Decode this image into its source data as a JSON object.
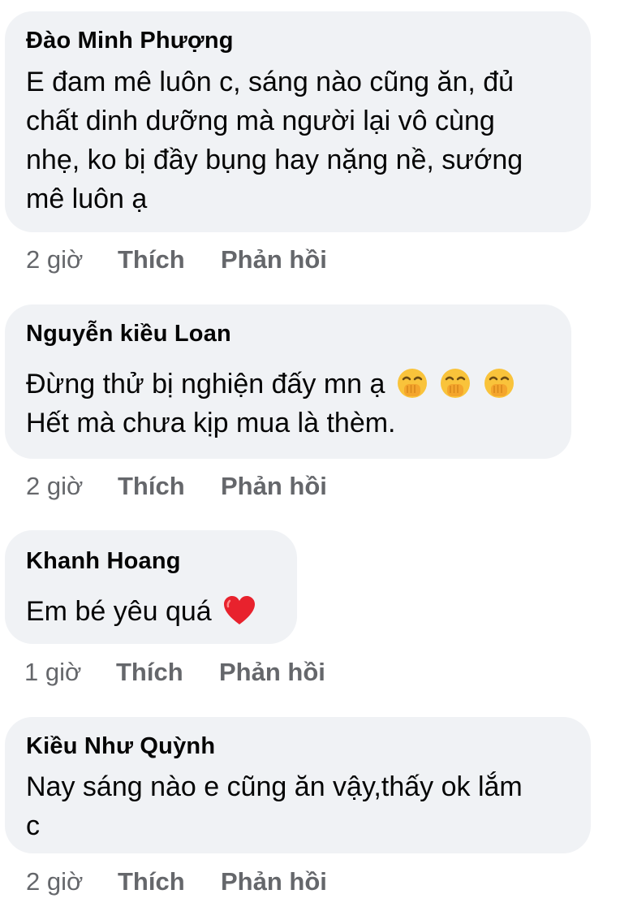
{
  "comments": [
    {
      "author": "Đào Minh Phượng",
      "lines": [
        "E đam mê luôn c, sáng nào cũng ăn, đủ",
        "chất dinh dưỡng mà người lại vô cùng",
        "nhẹ, ko bị đầy bụng hay nặng nề, sướng",
        "mê luôn ạ"
      ],
      "time": "2 giờ",
      "like_label": "Thích",
      "reply_label": "Phản hồi"
    },
    {
      "author": "Nguyễn kiều Loan",
      "lines": [
        "Đừng thử bị nghiện đấy mn ạ",
        "Hết mà chưa kịp mua là thèm."
      ],
      "emoji": [
        "face-with-hand-over-mouth-icon",
        "face-with-hand-over-mouth-icon",
        "face-with-hand-over-mouth-icon"
      ],
      "time": "2 giờ",
      "like_label": "Thích",
      "reply_label": "Phản hồi"
    },
    {
      "author": "Khanh Hoang",
      "lines": [
        "Em bé yêu quá"
      ],
      "emoji": [
        "red-heart-icon"
      ],
      "time": "1 giờ",
      "like_label": "Thích",
      "reply_label": "Phản hồi"
    },
    {
      "author": "Kiều Như Quỳnh",
      "lines": [
        "Nay sáng nào e cũng ăn vậy,thấy ok lắm",
        "c"
      ],
      "time": "2 giờ",
      "like_label": "Thích",
      "reply_label": "Phản hồi"
    }
  ],
  "colors": {
    "bubble": "#f0f2f5",
    "text": "#050505",
    "meta": "#65676b"
  }
}
